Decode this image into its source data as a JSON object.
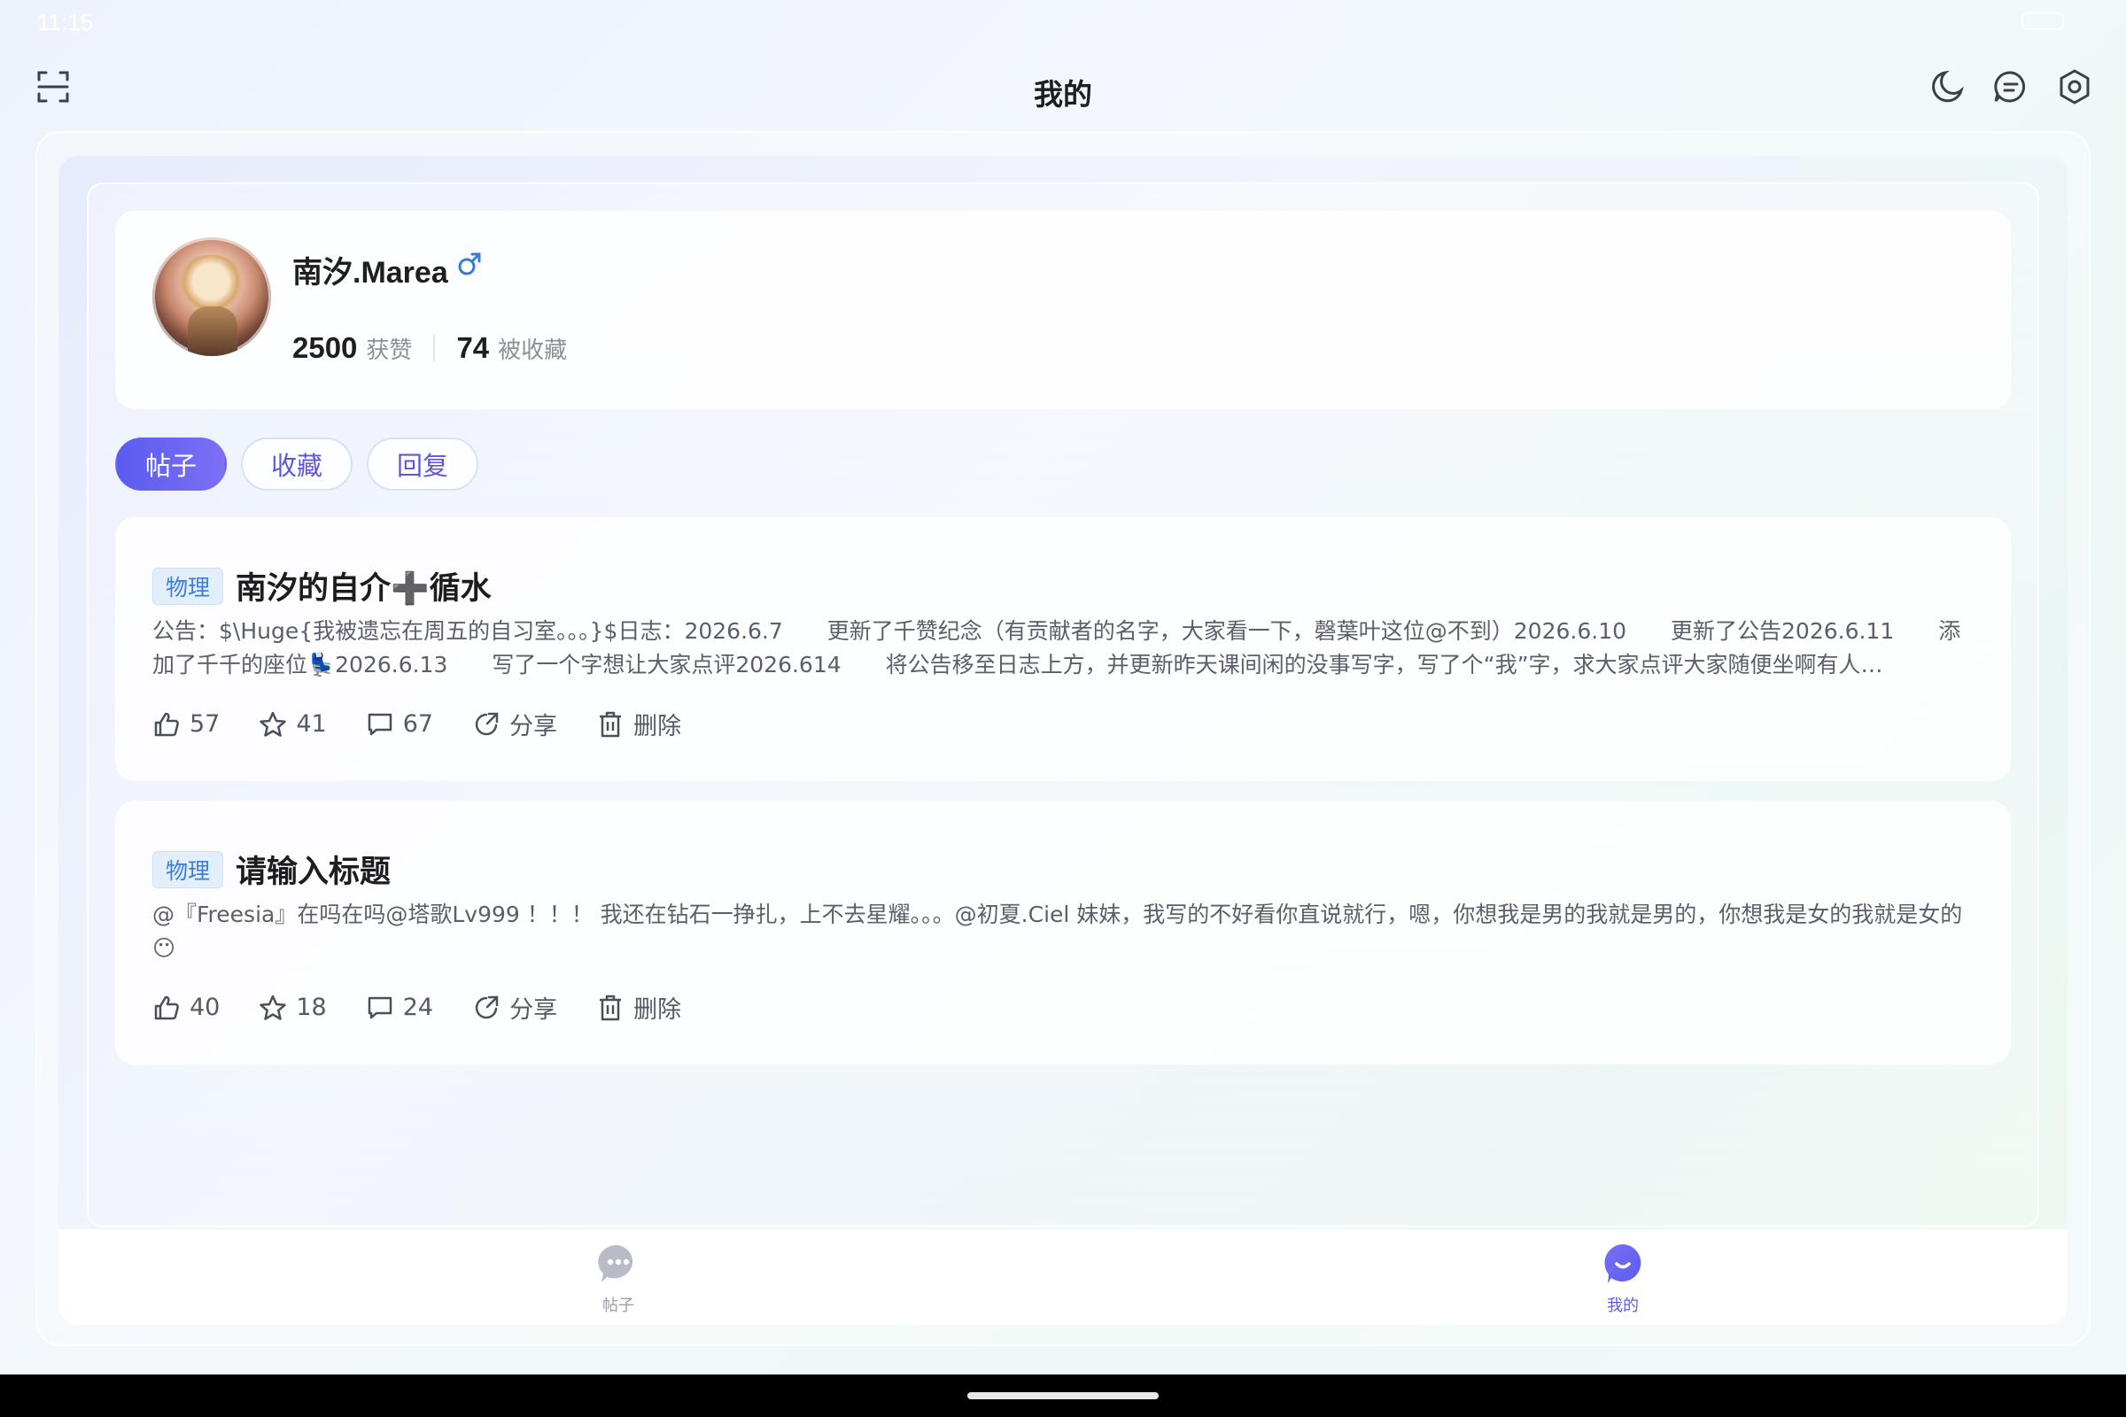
{
  "status": {
    "time": "11:15"
  },
  "header": {
    "title": "我的"
  },
  "icons": {
    "scan": "scan-icon",
    "theme": "moon-icon",
    "messages": "chat-icon",
    "settings": "settings-icon",
    "gender": "male-icon"
  },
  "profile": {
    "username": "南汐.Marea",
    "likes_count": "2500",
    "likes_label": "获赞",
    "favorites_count": "74",
    "favorites_label": "被收藏"
  },
  "tabs": [
    {
      "label": "帖子",
      "active": true
    },
    {
      "label": "收藏",
      "active": false
    },
    {
      "label": "回复",
      "active": false
    }
  ],
  "posts": [
    {
      "tag": "物理",
      "title_a": "南汐的自介",
      "title_b": "➕",
      "title_c": "循水",
      "body": "公告：$\\Huge{我被遗忘在周五的自习室。。。}$日志：2026.6.7　　更新了千赞纪念（有贡献者的名字，大家看一下，磬葉叶这位@不到）2026.6.10　　更新了公告2026.6.11　　添加了千千的座位💺2026.6.13　　写了一个字想让大家点评2026.614　　将公告移至日志上方，并更新昨天课间闲的没事写字，写了个“我”字，求大家点评大家随便坐啊有人…",
      "likes": "57",
      "stars": "41",
      "comments": "67",
      "share": "分享",
      "delete": "删除"
    },
    {
      "tag": "物理",
      "title": "请输入标题",
      "body": "@『Freesia』在吗在吗@塔歌Lv999 ！！！ 我还在钻石一挣扎，上不去星耀。。。@初夏.Ciel 妹妹，我写的不好看你直说就行，嗯，你想我是男的我就是男的，你想我是女的我就是女的😶",
      "likes": "40",
      "stars": "18",
      "comments": "24",
      "share": "分享",
      "delete": "删除"
    }
  ],
  "bottom_nav": [
    {
      "label": "帖子",
      "icon": "chat-bubble-dots-icon",
      "active": false
    },
    {
      "label": "我的",
      "icon": "profile-smile-icon",
      "active": true
    }
  ],
  "colors": {
    "accent": "#5a5cf0",
    "tag_text": "#3b7fd8",
    "tag_bg": "#e3eefb"
  }
}
